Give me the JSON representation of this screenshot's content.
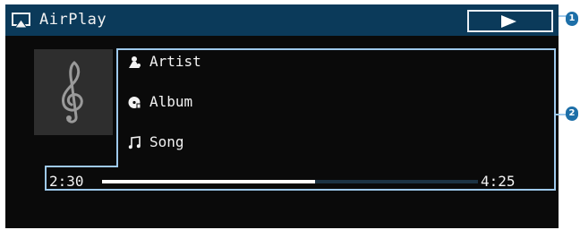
{
  "app": {
    "title": "AirPlay",
    "icon": "airplay-icon"
  },
  "controls": {
    "play_icon": "play-icon"
  },
  "track": {
    "artist_icon": "artist-icon",
    "artist": "Artist",
    "album_icon": "album-icon",
    "album": "Album",
    "song_icon": "note-icon",
    "song": "Song",
    "art_icon": "treble-clef-icon"
  },
  "playback": {
    "elapsed": "2:30",
    "total": "4:25",
    "progress_fraction": 0.566
  },
  "callouts": [
    {
      "label": "1"
    },
    {
      "label": "2"
    }
  ],
  "colors": {
    "title_bar": "#0b3a5a",
    "screen_background": "#0a0a0a",
    "highlight_border": "#9ec9ec",
    "callout_badge": "#1d6fa8"
  }
}
